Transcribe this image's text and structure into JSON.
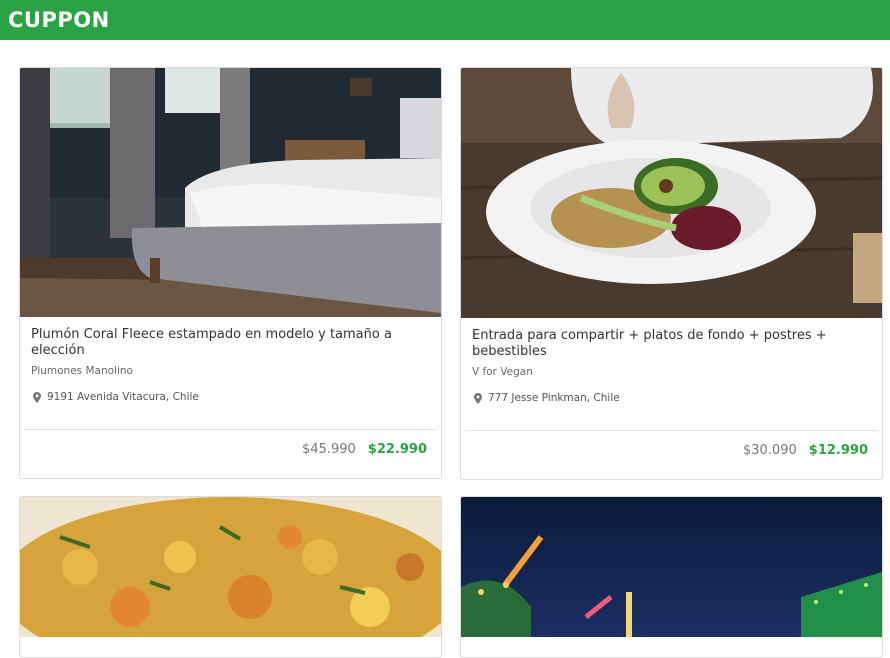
{
  "header": {
    "logo": "CUPPON",
    "brand_color": "#2aa345"
  },
  "deals": [
    {
      "title": "Plumón Coral Fleece estampado en modelo y tamaño a elección",
      "merchant": "Plumones Manolino",
      "location": "9191 Avenida Vitacura, Chile",
      "original_price": "$45.990",
      "discount_price": "$22.990",
      "image": "bedroom-photo"
    },
    {
      "title": "Entrada para compartir + platos de fondo + postres + bebestibles",
      "merchant": "V for Vegan",
      "location": "777 Jesse Pinkman, Chile",
      "original_price": "$30.090",
      "discount_price": "$12.990",
      "image": "vegan-salad-photo"
    },
    {
      "image": "vegetable-stew-photo"
    },
    {
      "image": "amusement-park-night-photo"
    }
  ],
  "icons": {
    "location": "map-pin-icon"
  }
}
